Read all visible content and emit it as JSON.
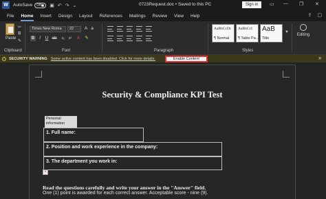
{
  "titlebar": {
    "logo": "W",
    "autosave": "AutoSave",
    "toggle": "Off",
    "doc_title": "0723Request.doc  •  Saved to this PC",
    "signin": "Sign in"
  },
  "tabs": [
    "File",
    "Home",
    "Insert",
    "Design",
    "Layout",
    "References",
    "Mailings",
    "Review",
    "View",
    "Help"
  ],
  "ribbon": {
    "paste": "Paste",
    "font_name": "Times New Roma",
    "font_size": "22",
    "styles": [
      {
        "sample": "AaBbCcDc",
        "name": "¶ Normal"
      },
      {
        "sample": "AaBbCcI",
        "name": "¶ Table Pa..."
      },
      {
        "sample": "AaB",
        "name": "Title"
      }
    ],
    "editing": "Editing",
    "groups": [
      "Clipboard",
      "Font",
      "Paragraph",
      "Styles"
    ]
  },
  "security_bar": {
    "title": "SECURITY WARNING",
    "message": "Some active content has been disabled. Click for more details.",
    "button": "Enable Content"
  },
  "document": {
    "heading": "Security & Compliance KPI Test",
    "field_tag": "Personal information",
    "fields": [
      "1. Full name:",
      "2. Position and work experience in the company:",
      "3. The department you work in:"
    ],
    "instruction": "Read the questions carefully and write your answer in the \"Answer\" field.",
    "instruction2": "One (1) point is awarded for each correct answer. Acceptable score - nine (9)."
  }
}
